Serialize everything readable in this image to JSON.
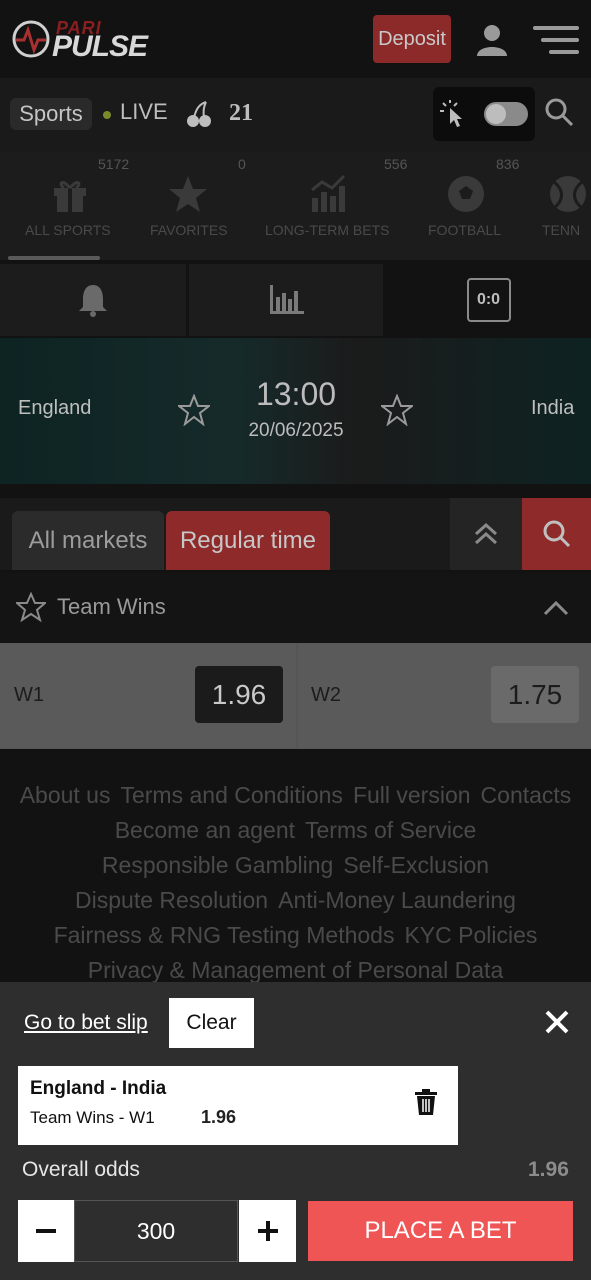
{
  "header": {
    "logo_top": "PARI",
    "logo_bottom": "PULSE",
    "deposit_label": "Deposit"
  },
  "nav": {
    "sports_label": "Sports",
    "live_label": "LIVE",
    "blackjack_label": "21"
  },
  "categories": [
    {
      "count": "5172",
      "label": "ALL SPORTS",
      "icon": "gift-icon"
    },
    {
      "count": "0",
      "label": "FAVORITES",
      "icon": "star-icon"
    },
    {
      "count": "556",
      "label": "LONG-TERM BETS",
      "icon": "bar-chart-icon"
    },
    {
      "count": "836",
      "label": "FOOTBALL",
      "icon": "soccer-ball-icon"
    },
    {
      "count": "",
      "label": "TENN",
      "icon": "tennis-ball-icon"
    }
  ],
  "tools": {
    "score_label": "0:0"
  },
  "match": {
    "team_home": "England",
    "team_away": "India",
    "time": "13:00",
    "date": "20/06/2025"
  },
  "market_tabs": [
    {
      "label": "All markets"
    },
    {
      "label": "Regular time"
    }
  ],
  "team_wins": {
    "title": "Team Wins",
    "w1_label": "W1",
    "w1_odd": "1.96",
    "w2_label": "W2",
    "w2_odd": "1.75"
  },
  "footer": {
    "links": [
      "About us",
      "Terms and Conditions",
      "Full version",
      "Contacts",
      "Become an agent",
      "Terms of Service",
      "Responsible Gambling",
      "Self-Exclusion",
      "Dispute Resolution",
      "Anti-Money Laundering",
      "Fairness & RNG Testing Methods",
      "KYC Policies",
      "Privacy & Management of Personal Data"
    ]
  },
  "bet_slip": {
    "goto_label": "Go to bet slip",
    "clear_label": "Clear",
    "match_name": "England - India",
    "market": "Team Wins - W1",
    "odd": "1.96",
    "overall_label": "Overall odds",
    "overall_value": "1.96",
    "stake": "300",
    "place_label": "PLACE A BET"
  },
  "colors": {
    "accent_red": "#f05555",
    "dark_red": "#8e2a2a",
    "background": "#121212"
  }
}
